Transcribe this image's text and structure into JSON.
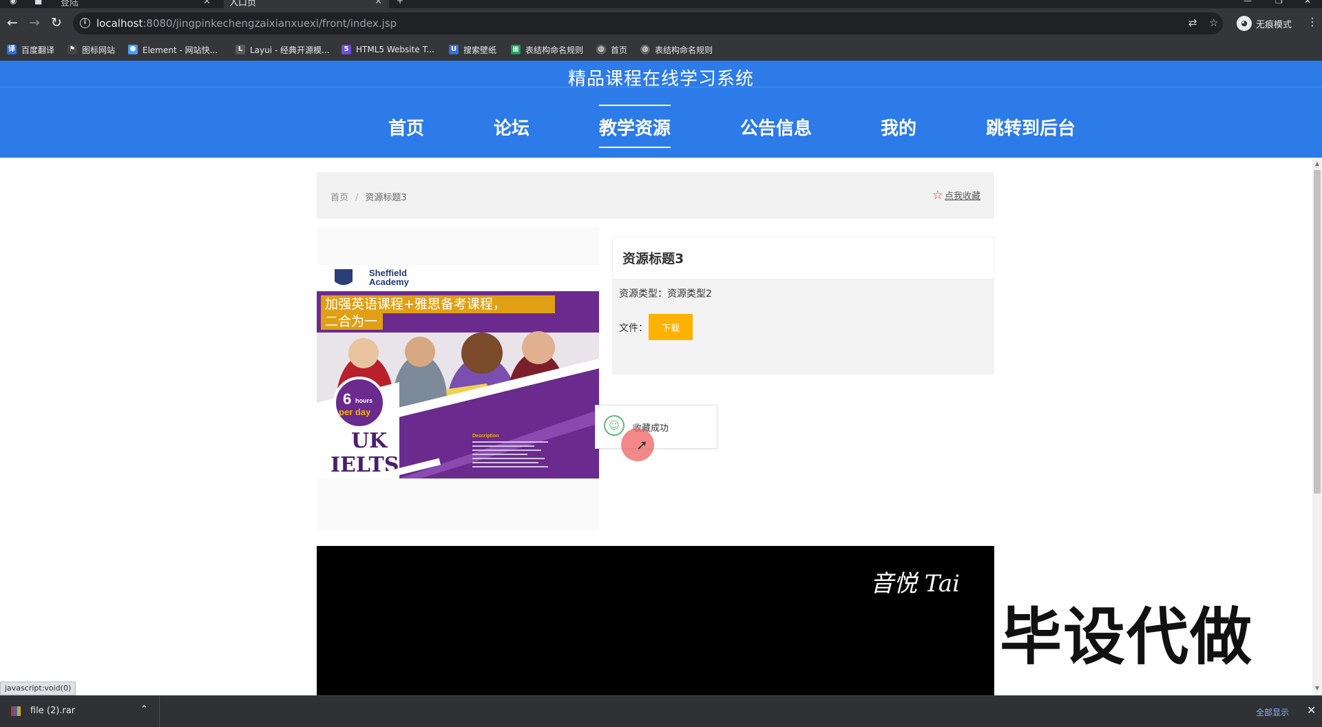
{
  "browser": {
    "tabs": [
      {
        "label": "登陆",
        "active": false
      },
      {
        "label": "入口页",
        "active": true
      }
    ],
    "url_host": "localhost",
    "url_path": ":8080/jingpinkechengzaixianxuexi/front/index.jsp",
    "profile_label": "无痕模式",
    "bookmarks": [
      {
        "label": "百度翻译",
        "icon": "translate-icon",
        "color": "#2a6ee8"
      },
      {
        "label": "图标网站",
        "icon": "flag-icon",
        "color": "#444444"
      },
      {
        "label": "Element - 网站快...",
        "icon": "element-icon",
        "color": "#409eff"
      },
      {
        "label": "Layui - 经典开源模...",
        "icon": "layui-icon",
        "color": "#5a5a5a"
      },
      {
        "label": "HTML5 Website T...",
        "icon": "html5-icon",
        "color": "#6b4fd8"
      },
      {
        "label": "搜索壁纸",
        "icon": "wallpaper-icon",
        "color": "#3a6fd8"
      },
      {
        "label": "表结构命名规则",
        "icon": "sheet-icon",
        "color": "#1e9e5a"
      },
      {
        "label": "首页",
        "icon": "globe-icon",
        "color": "#666666"
      },
      {
        "label": "表结构命名规则",
        "icon": "globe-icon",
        "color": "#666666"
      }
    ]
  },
  "site": {
    "title": "精品课程在线学习系统",
    "header_color": "#2d7be8",
    "nav": [
      {
        "label": "首页",
        "active": false
      },
      {
        "label": "论坛",
        "active": false
      },
      {
        "label": "教学资源",
        "active": true
      },
      {
        "label": "公告信息",
        "active": false
      },
      {
        "label": "我的",
        "active": false
      },
      {
        "label": "跳转到后台",
        "active": false
      }
    ]
  },
  "breadcrumb": {
    "home": "首页",
    "separator": "/",
    "current": "资源标题3",
    "favorite_label": "点我收藏"
  },
  "poster": {
    "brand_line1": "Sheffield",
    "brand_line2": "Academy",
    "headline_line1": "加强英语课程+雅思备考课程，",
    "headline_line2": "二合为一",
    "badge_number": "6",
    "badge_unit": "hours",
    "badge_sub": "per day",
    "big_line1": "UK",
    "big_line2": "IELTS",
    "desc_heading": "Description"
  },
  "resource": {
    "title": "资源标题3",
    "type_label": "资源类型：",
    "type_value": "资源类型2",
    "file_label": "文件：",
    "download_label": "下载",
    "download_color": "#ffb100"
  },
  "toast": {
    "message": "收藏成功",
    "icon": "smile-icon"
  },
  "overlay": {
    "signature": "音悦 Tai",
    "watermark": "毕设代做"
  },
  "status_bar": {
    "hover_text": "javascript:void(0)",
    "download_file": "file (2).rar",
    "show_all": "全部显示"
  }
}
